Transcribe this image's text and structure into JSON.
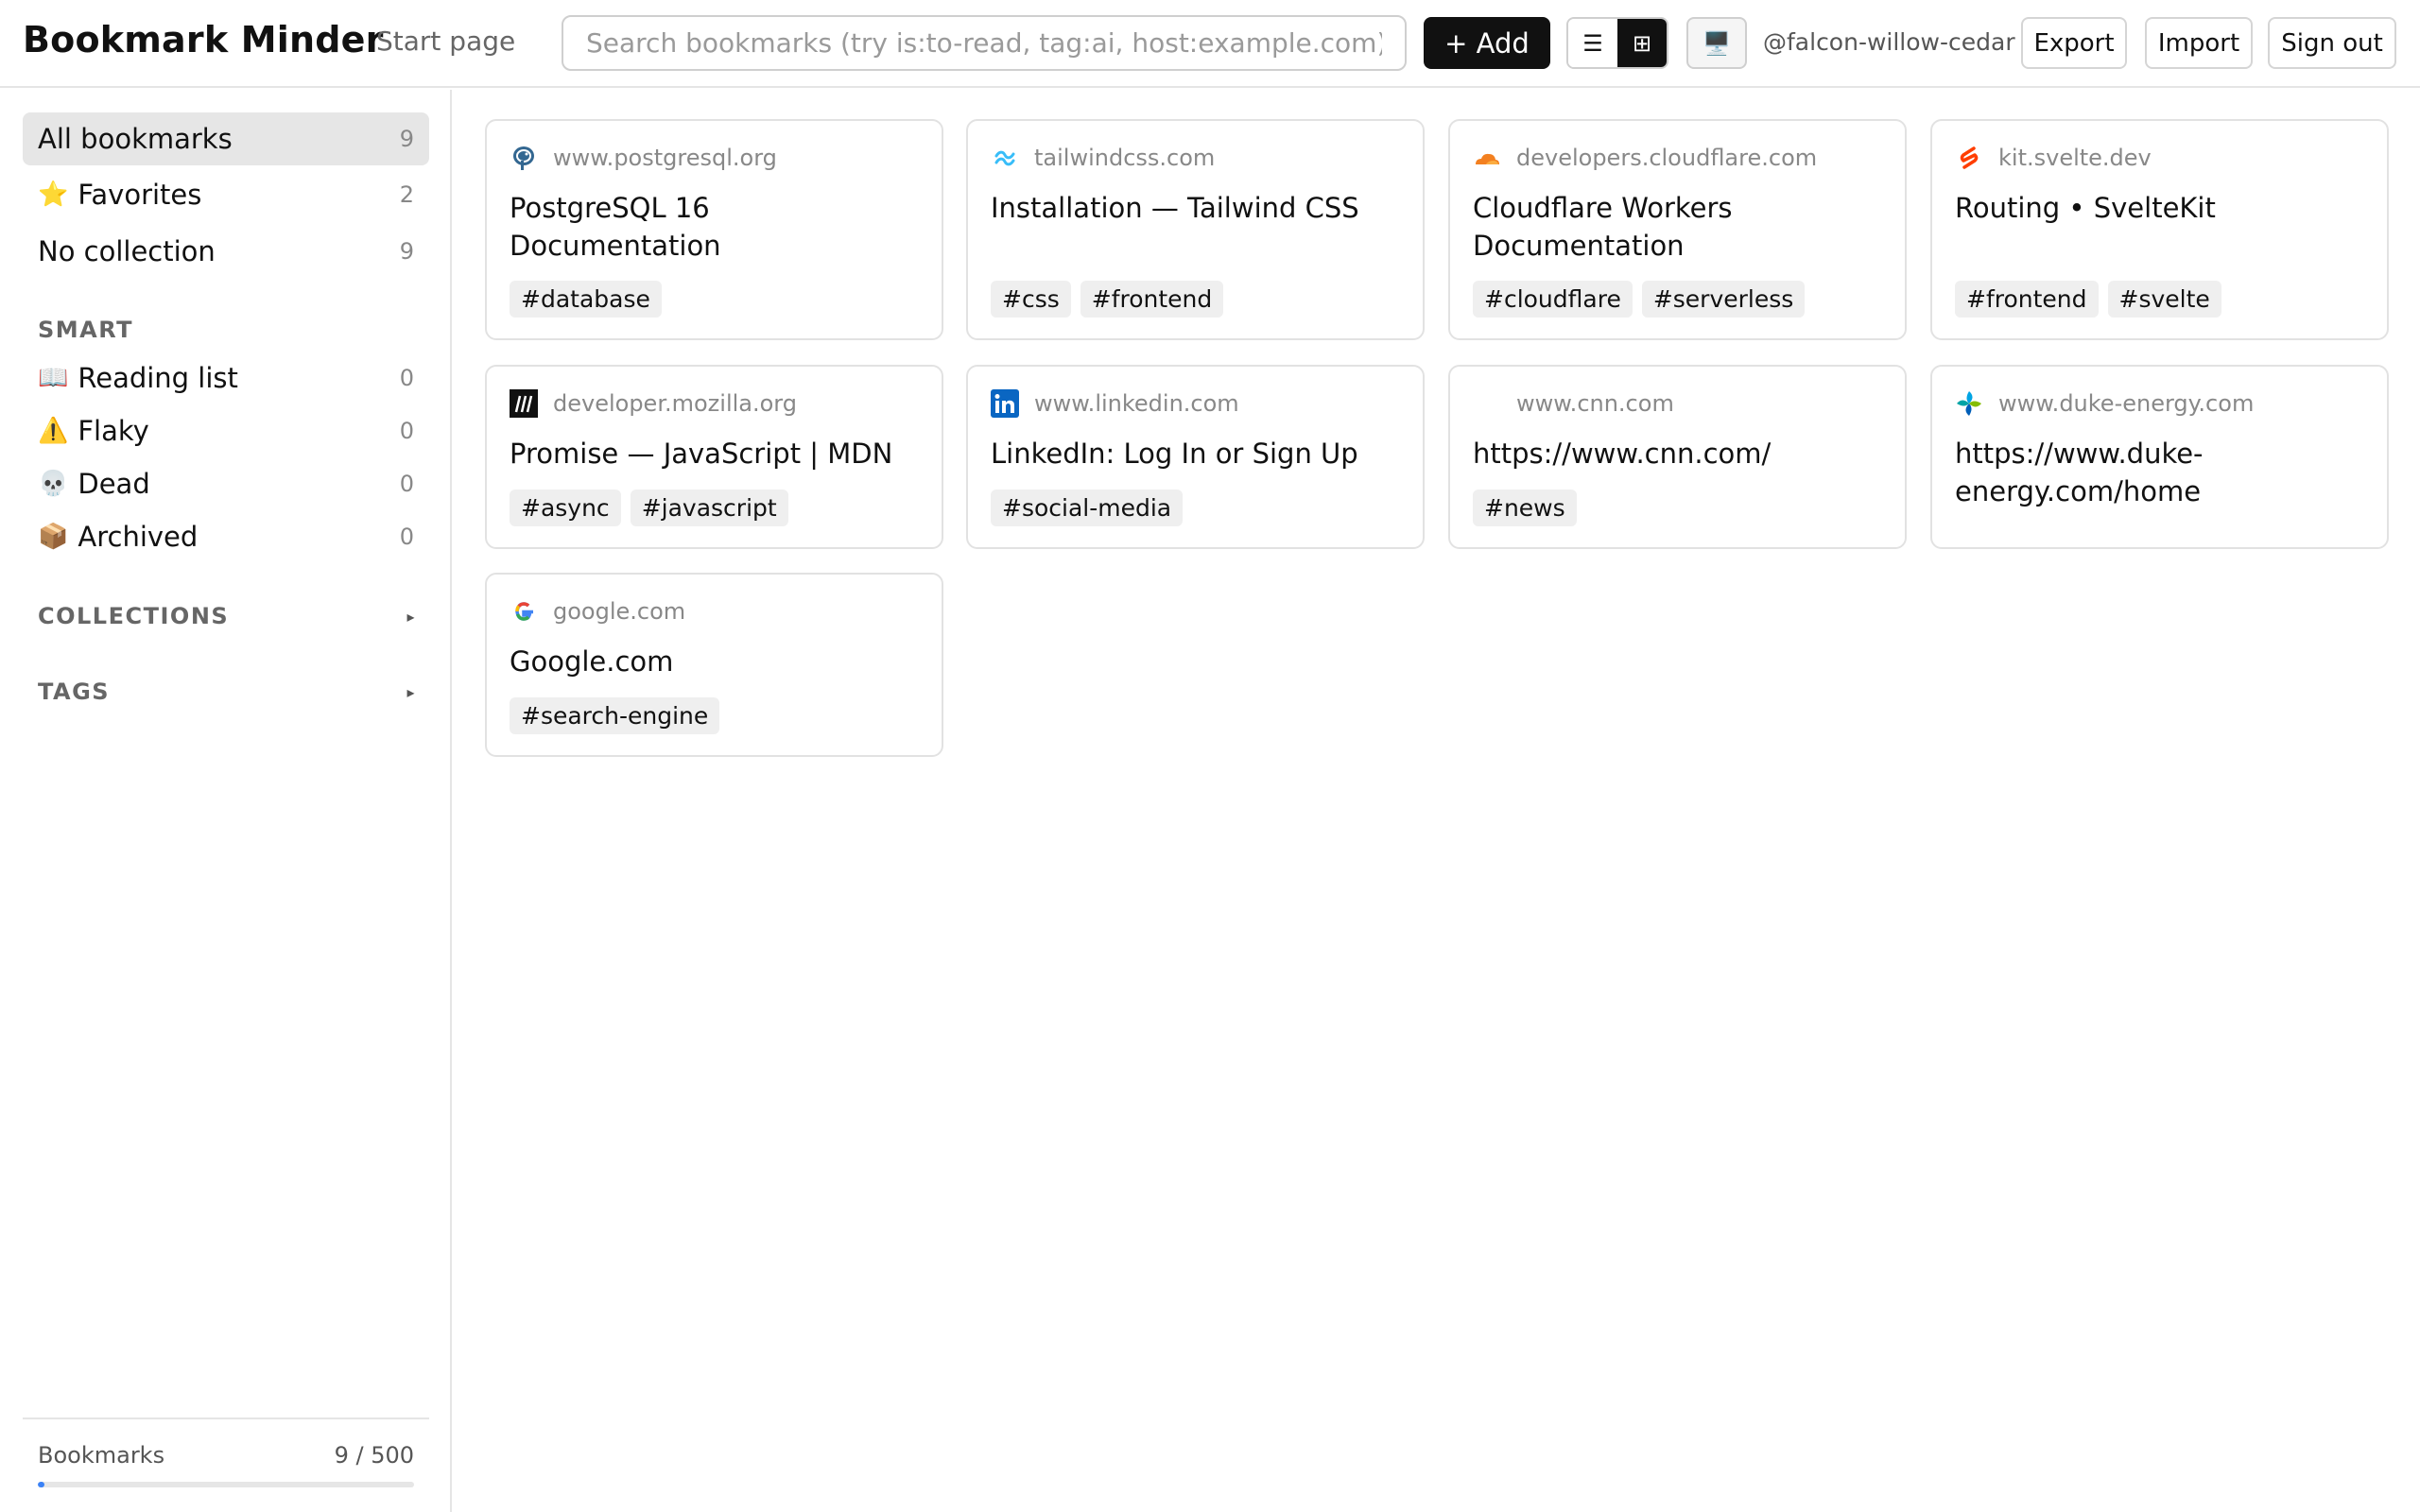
{
  "header": {
    "brand": "Bookmark Minder",
    "start_page": "Start page",
    "search_placeholder": "Search bookmarks (try is:to-read, tag:ai, host:example.com)",
    "add_label": "+ Add",
    "view_list_icon": "☰",
    "view_grid_icon": "⊞",
    "display_icon": "🖥️",
    "username": "@falcon-willow-cedar",
    "export_label": "Export",
    "import_label": "Import",
    "signout_label": "Sign out"
  },
  "sidebar": {
    "items": [
      {
        "label": "All bookmarks",
        "count": "9",
        "emoji": ""
      },
      {
        "label": "Favorites",
        "count": "2",
        "emoji": "⭐"
      },
      {
        "label": "No collection",
        "count": "9",
        "emoji": ""
      }
    ],
    "smart_heading": "SMART",
    "smart": [
      {
        "label": "Reading list",
        "count": "0",
        "emoji": "📖"
      },
      {
        "label": "Flaky",
        "count": "0",
        "emoji": "⚠️"
      },
      {
        "label": "Dead",
        "count": "0",
        "emoji": "💀"
      },
      {
        "label": "Archived",
        "count": "0",
        "emoji": "📦"
      }
    ],
    "collections_heading": "COLLECTIONS",
    "tags_heading": "TAGS",
    "caret": "▸",
    "quota": {
      "label": "Bookmarks",
      "value": "9 / 500",
      "fraction": 0.018
    }
  },
  "bookmarks": [
    {
      "host": "www.postgresql.org",
      "title": "PostgreSQL 16 Documentation",
      "tags": [
        "#database"
      ],
      "icon": "postgresql-elephant-icon",
      "color": "#336791"
    },
    {
      "host": "tailwindcss.com",
      "title": "Installation — Tailwind CSS",
      "tags": [
        "#css",
        "#frontend"
      ],
      "icon": "tailwind-wave-icon",
      "color": "#38bdf8"
    },
    {
      "host": "developers.cloudflare.com",
      "title": "Cloudflare Workers Documentation",
      "tags": [
        "#cloudflare",
        "#serverless"
      ],
      "icon": "cloudflare-cloud-icon",
      "color": "#f38020"
    },
    {
      "host": "kit.svelte.dev",
      "title": "Routing • SvelteKit",
      "tags": [
        "#frontend",
        "#svelte"
      ],
      "icon": "svelte-logo-icon",
      "color": "#ff3e00"
    },
    {
      "host": "developer.mozilla.org",
      "title": "Promise — JavaScript | MDN",
      "tags": [
        "#async",
        "#javascript"
      ],
      "icon": "mdn-logo-icon",
      "color": "#111111"
    },
    {
      "host": "www.linkedin.com",
      "title": "LinkedIn: Log In or Sign Up",
      "tags": [
        "#social-media"
      ],
      "icon": "linkedin-logo-icon",
      "color": "#0a66c2"
    },
    {
      "host": "www.cnn.com",
      "title": "https://www.cnn.com/",
      "tags": [
        "#news"
      ],
      "icon": "blank-favicon",
      "color": "#ffffff"
    },
    {
      "host": "www.duke-energy.com",
      "title": "https://www.duke-energy.com/home",
      "tags": [],
      "icon": "duke-energy-logo-icon",
      "color": "#00a4e4"
    },
    {
      "host": "google.com",
      "title": "Google.com",
      "tags": [
        "#search-engine"
      ],
      "icon": "google-g-icon",
      "color": "#4285f4"
    }
  ]
}
